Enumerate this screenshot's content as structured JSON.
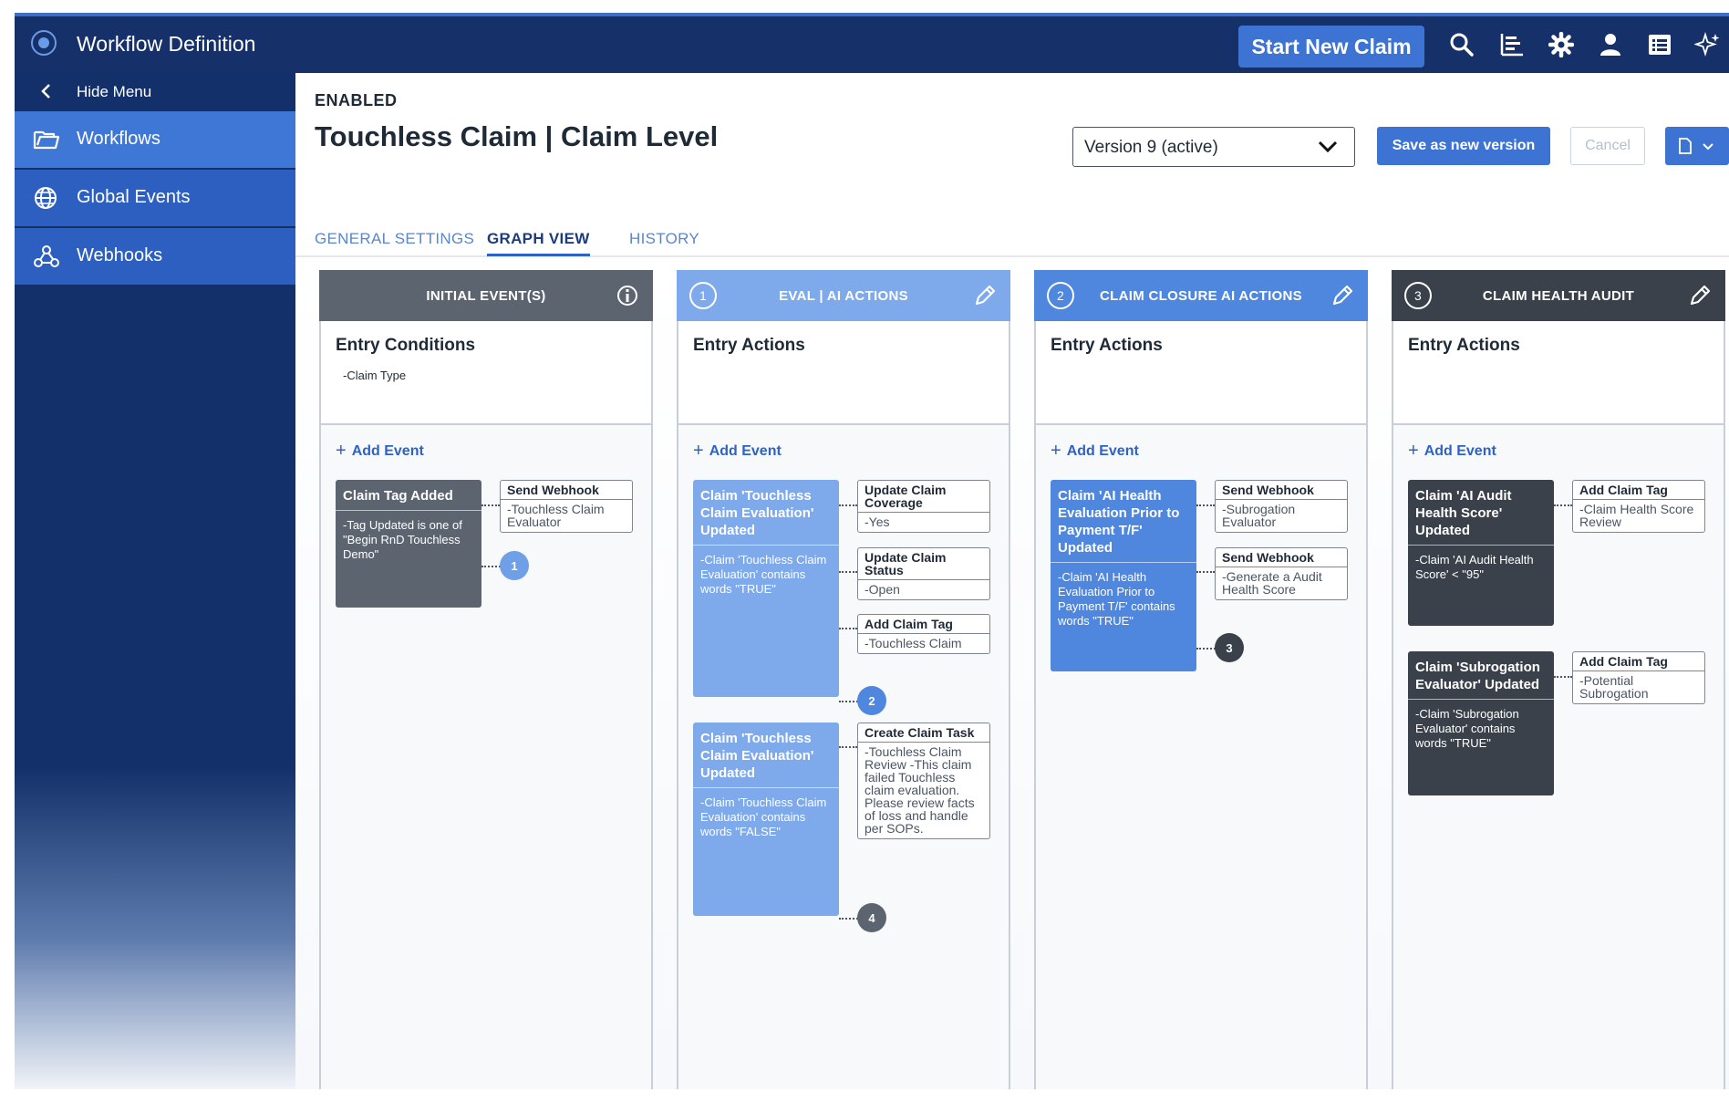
{
  "header": {
    "app_title": "Workflow Definition",
    "start_claim_label": "Start New Claim",
    "icons": [
      "search-icon",
      "chart-icon",
      "gear-icon",
      "user-icon",
      "table-icon",
      "sparkle-icon"
    ]
  },
  "sidebar": {
    "hide_menu_label": "Hide Menu",
    "items": [
      {
        "label": "Workflows",
        "icon": "folder-icon"
      },
      {
        "label": "Global Events",
        "icon": "globe-icon"
      },
      {
        "label": "Webhooks",
        "icon": "webhook-icon"
      }
    ]
  },
  "page": {
    "status": "ENABLED",
    "title": "Touchless Claim | Claim Level",
    "version": "Version 9 (active)",
    "save_label": "Save as new version",
    "cancel_label": "Cancel"
  },
  "tabs": [
    {
      "label": "GENERAL SETTINGS"
    },
    {
      "label": "GRAPH VIEW"
    },
    {
      "label": "HISTORY"
    }
  ],
  "columns": [
    {
      "title": "INITIAL EVENT(S)",
      "number": "",
      "color": "#5c6470",
      "entry_title": "Entry Conditions",
      "entry_sub": "-Claim Type",
      "add_event": "Add Event",
      "events": [
        {
          "title": "Claim Tag Added",
          "body": "-Tag Updated is one of \"Begin RnD Touchless Demo\""
        }
      ],
      "actions": [
        {
          "title": "Send Webhook",
          "body": "-Touchless Claim Evaluator"
        }
      ],
      "badges": [
        "1"
      ]
    },
    {
      "title": "EVAL | AI ACTIONS",
      "number": "1",
      "color": "#7ea9ea",
      "entry_title": "Entry Actions",
      "add_event": "Add Event",
      "events": [
        {
          "title": "Claim 'Touchless Claim Evaluation' Updated",
          "body": "-Claim 'Touchless Claim Evaluation' contains words \"TRUE\""
        },
        {
          "title": "Claim 'Touchless Claim Evaluation' Updated",
          "body": "-Claim 'Touchless Claim Evaluation' contains words \"FALSE\""
        }
      ],
      "actions": [
        {
          "title": "Update Claim Coverage",
          "body": "-Yes"
        },
        {
          "title": "Update Claim Status",
          "body": "-Open"
        },
        {
          "title": "Add Claim Tag",
          "body": "-Touchless Claim"
        },
        {
          "title": "Create Claim Task",
          "body": "-Touchless Claim Review -This claim failed Touchless claim evaluation. Please review facts of loss and handle per SOPs."
        }
      ],
      "badges": [
        "2",
        "4"
      ]
    },
    {
      "title": "CLAIM CLOSURE AI ACTIONS",
      "number": "2",
      "color": "#4f86de",
      "entry_title": "Entry Actions",
      "add_event": "Add Event",
      "events": [
        {
          "title": "Claim 'AI Health Evaluation Prior to Payment T/F' Updated",
          "body": "-Claim 'AI Health Evaluation Prior to Payment T/F' contains words \"TRUE\""
        }
      ],
      "actions": [
        {
          "title": "Send Webhook",
          "body": "-Subrogation Evaluator"
        },
        {
          "title": "Send Webhook",
          "body": "-Generate a Audit Health Score"
        }
      ],
      "badges": [
        "3"
      ]
    },
    {
      "title": "CLAIM HEALTH AUDIT",
      "number": "3",
      "color": "#3b414b",
      "entry_title": "Entry Actions",
      "add_event": "Add Event",
      "events": [
        {
          "title": "Claim 'AI Audit Health Score' Updated",
          "body": "-Claim 'AI Audit Health Score' < \"95\""
        },
        {
          "title": "Claim 'Subrogation Evaluator' Updated",
          "body": "-Claim 'Subrogation Evaluator' contains words \"TRUE\""
        }
      ],
      "actions": [
        {
          "title": "Add Claim Tag",
          "body": "-Claim Health Score Review"
        },
        {
          "title": "Add Claim Tag",
          "body": "-Potential Subrogation"
        }
      ],
      "badges": []
    }
  ]
}
